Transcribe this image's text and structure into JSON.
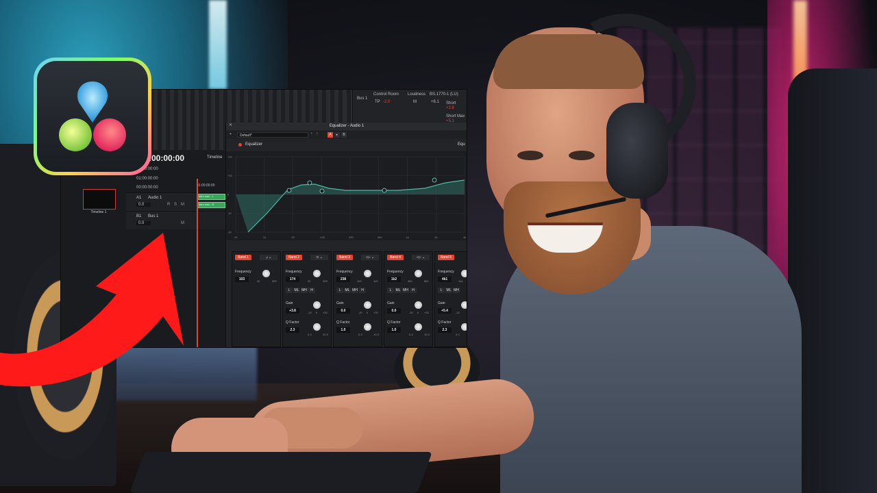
{
  "logo": {
    "icon": "davinci-resolve-logo-icon"
  },
  "resolve": {
    "top_right": {
      "bus": "Bus 1",
      "control_room": "Control Room",
      "loudness": "Loudness",
      "standard": "BS.1770-1 (LU)",
      "tp": "TP",
      "tp_value": "-2.0",
      "m": "M",
      "m_value": "+6.1",
      "short": "Short",
      "short_value": "+2.8",
      "short_max": "Short Max",
      "short_max_value": "+5.1"
    },
    "timecode": "01:00:00:00",
    "timecode_display": ":00:00:00",
    "timeline_label": "Timeline",
    "tc_rows": [
      "01:00:00:00",
      "01:00:00:00",
      "00:00:00:00"
    ],
    "ruler_tc": "01:00:00:00",
    "tracks": [
      {
        "id": "A1",
        "name": "Audio 1",
        "value": "0.0"
      },
      {
        "id": "B1",
        "name": "Bus 1",
        "value": "0.0"
      }
    ],
    "track_buttons": [
      "R",
      "S",
      "M"
    ],
    "thumb_label": "Timeline 1",
    "clips": [
      "intro.wav - L",
      "intro.wav - R"
    ],
    "eq": {
      "title": "Equalizer - Audio 1",
      "preset": "Default*",
      "a_label": "A",
      "b_label": "B",
      "plus": "+",
      "section_label": "Equalizer",
      "right_label": "Equ",
      "y_ticks": [
        "+20",
        "+10",
        "0",
        "-10",
        "-20"
      ],
      "x_ticks": [
        "20",
        "31",
        "50",
        "125",
        "250",
        "500",
        "1k",
        "2k",
        "4k"
      ],
      "bands": [
        {
          "label": "Band 1",
          "shape": "╭ ⌄",
          "frequency": "103",
          "f_min": "30",
          "f_max": "399"
        },
        {
          "label": "Band 2",
          "shape": "⊃ ⌄",
          "frequency": "174",
          "f_min": "30",
          "f_max": "399",
          "gain": "+3.8",
          "q": "2.3"
        },
        {
          "label": "Band 3",
          "shape": "-◇- ⌄",
          "frequency": "238",
          "f_min": "100",
          "f_max": "1k5",
          "gain": "0.0",
          "q": "1.0"
        },
        {
          "label": "Band 4",
          "shape": "-◇- ⌄",
          "frequency": "1k2",
          "f_min": "450",
          "f_max": "8k0",
          "gain": "0.0",
          "q": "1.0"
        },
        {
          "label": "Band 5",
          "shape": "-◇-",
          "frequency": "4k1",
          "f_min": "1k4",
          "f_max": "",
          "gain": "+5.4",
          "q": "2.3"
        }
      ],
      "frequency_label": "Frequency",
      "gain_label": "Gain",
      "q_label": "Q Factor",
      "gain_min": "-20",
      "gain_mid": "0",
      "gain_max": "+20",
      "q_min": "0.3",
      "q_max": "10.3",
      "ml_buttons": [
        "L",
        "ML",
        "MH",
        "H"
      ]
    }
  },
  "colors": {
    "accent": "#e04632",
    "eq_curve": "#4fb8a8",
    "arrow": "#ff1a1a"
  }
}
